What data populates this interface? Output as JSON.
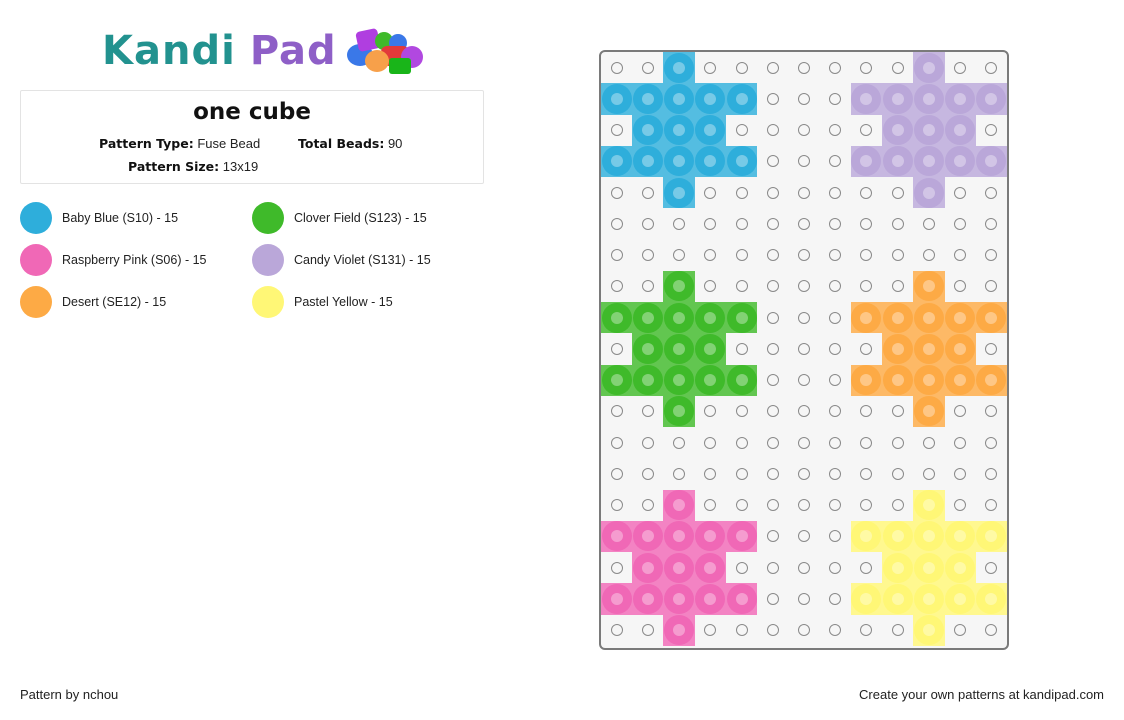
{
  "logo": {
    "brand_part1": "Kandi",
    "brand_part2": "Pad",
    "colors": {
      "kandi": "#22928f",
      "pad": "#8e5fc7"
    }
  },
  "pattern": {
    "title": "one cube",
    "type_label": "Pattern Type:",
    "type_value": "Fuse Bead",
    "total_label": "Total Beads:",
    "total_value": "90",
    "size_label": "Pattern Size:",
    "size_value": "13x19"
  },
  "legend": [
    {
      "key": "B",
      "name": "Baby Blue (S10) - 15",
      "color": "#2eaedb"
    },
    {
      "key": "G",
      "name": "Clover Field (S123) - 15",
      "color": "#3fba2a"
    },
    {
      "key": "P",
      "name": "Raspberry Pink (S06) - 15",
      "color": "#f068b6"
    },
    {
      "key": "V",
      "name": "Candy Violet (S131) - 15",
      "color": "#baa7d9"
    },
    {
      "key": "O",
      "name": "Desert (SE12) - 15",
      "color": "#fdaa45"
    },
    {
      "key": "Y",
      "name": "Pastel Yellow - 15",
      "color": "#fff776"
    }
  ],
  "grid": {
    "columns": 13,
    "rows_count": 19,
    "rows": [
      "..B.......V..",
      "BBBBB...VVVVV",
      ".BBB.....VVV.",
      "BBBBB...VVVVV",
      "..B.......V..",
      ".............",
      ".............",
      "..G.......O..",
      "GGGGG...OOOOO",
      ".GGG.....OOO.",
      "GGGGG...OOOOO",
      "..G.......O..",
      ".............",
      ".............",
      "..P.......Y..",
      "PPPPP...YYYYY",
      ".PPP.....YYY.",
      "PPPPP...YYYYY",
      "..P.......Y.."
    ]
  },
  "footer": {
    "author": "Pattern by nchou",
    "cta": "Create your own patterns at kandipad.com"
  }
}
